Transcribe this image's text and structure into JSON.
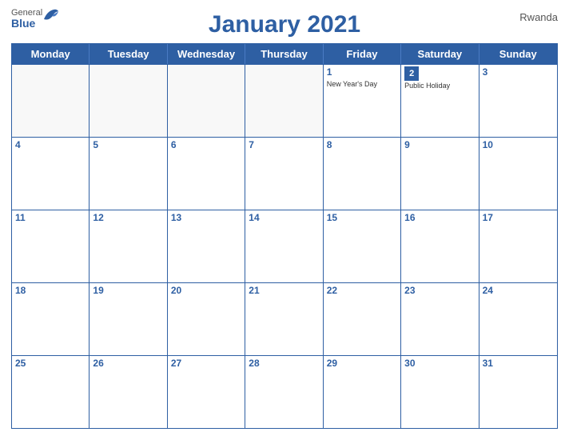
{
  "header": {
    "logo": {
      "general": "General",
      "blue": "Blue"
    },
    "title": "January 2021",
    "country": "Rwanda"
  },
  "days_of_week": [
    "Monday",
    "Tuesday",
    "Wednesday",
    "Thursday",
    "Friday",
    "Saturday",
    "Sunday"
  ],
  "weeks": [
    [
      {
        "date": "",
        "events": []
      },
      {
        "date": "",
        "events": []
      },
      {
        "date": "",
        "events": []
      },
      {
        "date": "",
        "events": []
      },
      {
        "date": "1",
        "events": [
          "New Year's Day"
        ]
      },
      {
        "date": "2",
        "events": [
          "Public Holiday"
        ]
      },
      {
        "date": "3",
        "events": []
      }
    ],
    [
      {
        "date": "4",
        "events": []
      },
      {
        "date": "5",
        "events": []
      },
      {
        "date": "6",
        "events": []
      },
      {
        "date": "7",
        "events": []
      },
      {
        "date": "8",
        "events": []
      },
      {
        "date": "9",
        "events": []
      },
      {
        "date": "10",
        "events": []
      }
    ],
    [
      {
        "date": "11",
        "events": []
      },
      {
        "date": "12",
        "events": []
      },
      {
        "date": "13",
        "events": []
      },
      {
        "date": "14",
        "events": []
      },
      {
        "date": "15",
        "events": []
      },
      {
        "date": "16",
        "events": []
      },
      {
        "date": "17",
        "events": []
      }
    ],
    [
      {
        "date": "18",
        "events": []
      },
      {
        "date": "19",
        "events": []
      },
      {
        "date": "20",
        "events": []
      },
      {
        "date": "21",
        "events": []
      },
      {
        "date": "22",
        "events": []
      },
      {
        "date": "23",
        "events": []
      },
      {
        "date": "24",
        "events": []
      }
    ],
    [
      {
        "date": "25",
        "events": []
      },
      {
        "date": "26",
        "events": []
      },
      {
        "date": "27",
        "events": []
      },
      {
        "date": "28",
        "events": []
      },
      {
        "date": "29",
        "events": []
      },
      {
        "date": "30",
        "events": []
      },
      {
        "date": "31",
        "events": []
      }
    ]
  ],
  "colors": {
    "header_bg": "#2e5fa3",
    "accent": "#2e5fa3",
    "text_light": "#ffffff",
    "text_dark": "#333333"
  }
}
